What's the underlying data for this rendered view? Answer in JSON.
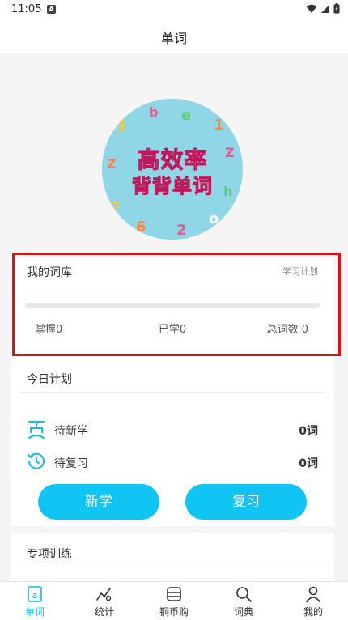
{
  "status_bar": {
    "time": "11:05",
    "notification_badge": "A"
  },
  "header": {
    "title": "单词"
  },
  "cover": {
    "line1": "高效率",
    "line2": "背背单词"
  },
  "library": {
    "title": "我的词库",
    "plan_link": "学习计划",
    "progress_fraction": 0,
    "mastered": "掌握0",
    "learned": "已学0",
    "total": "总词数 0"
  },
  "today_plan": {
    "title": "今日计划",
    "new_label": "待新学",
    "new_count": "0词",
    "review_label": "待复习",
    "review_count": "0词",
    "new_button": "新学",
    "review_button": "复习"
  },
  "special_training": {
    "title": "专项训练"
  },
  "tabs": [
    {
      "label": "单词",
      "icon": "word-book-icon",
      "active": true
    },
    {
      "label": "统计",
      "icon": "chart-icon",
      "active": false
    },
    {
      "label": "铜币购",
      "icon": "coin-shop-icon",
      "active": false
    },
    {
      "label": "词典",
      "icon": "search-icon",
      "active": false
    },
    {
      "label": "我的",
      "icon": "user-icon",
      "active": false
    }
  ],
  "colors": {
    "accent": "#10c5f4",
    "highlight_border": "#d81414",
    "active_tab": "#16b7ea"
  }
}
